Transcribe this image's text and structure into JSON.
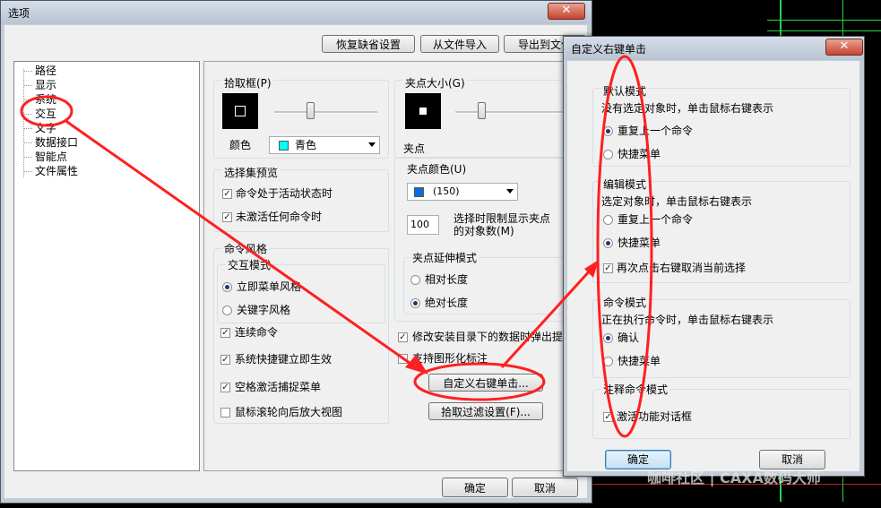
{
  "options_dialog": {
    "title": "选项",
    "close_glyph": "✕",
    "top_buttons": {
      "restore": "恢复缺省设置",
      "import": "从文件导入",
      "export": "导出到文件"
    },
    "tree": [
      "路径",
      "显示",
      "系统",
      "交互",
      "文字",
      "数据接口",
      "智能点",
      "文件属性"
    ],
    "pickbox": {
      "title": "拾取框(P)",
      "color_label": "颜色",
      "color_value": "青色",
      "color_hex": "#00ffff"
    },
    "grip_size": {
      "title": "夹点大小(G)"
    },
    "grip": {
      "title": "夹点",
      "color_label": "夹点颜色(U)",
      "color_value": "(150)",
      "color_hex": "#0a6edc",
      "limit_value": "100",
      "limit_label_1": "选择时限制显示夹点",
      "limit_label_2": "的对象数(M)"
    },
    "grip_extend": {
      "title": "夹点延伸模式",
      "relative": "相对长度",
      "absolute": "绝对长度"
    },
    "selection_preview": {
      "title": "选择集预览",
      "opt1": "命令处于活动状态时",
      "opt2": "未激活任何命令时"
    },
    "command_style": {
      "title": "命令风格",
      "interact_title": "交互模式",
      "menu_style": "立即菜单风格",
      "keyword_style": "关键字风格"
    },
    "checks": {
      "continuous": "连续命令",
      "shortcut": "系统快捷键立即生效",
      "space": "空格激活捕捉菜单",
      "wheel": "鼠标滚轮向后放大视图",
      "modify_install": "修改安装目录下的数据时弹出提",
      "support_graphic": "支持图形化标注"
    },
    "custom_right_click_btn": "自定义右键单击...",
    "pick_filter_btn": "拾取过滤设置(F)...",
    "ok": "确定",
    "cancel": "取消"
  },
  "right_click_dialog": {
    "title": "自定义右键单击",
    "close_glyph": "✕",
    "default_mode": {
      "title": "默认模式",
      "desc": "没有选定对象时，单击鼠标右键表示",
      "opt1": "重复上一个命令",
      "opt2": "快捷菜单"
    },
    "edit_mode": {
      "title": "编辑模式",
      "desc": "选定对象时，单击鼠标右键表示",
      "opt1": "重复上一个命令",
      "opt2": "快捷菜单",
      "check": "再次点击右键取消当前选择"
    },
    "command_mode": {
      "title": "命令模式",
      "desc": "正在执行命令时，单击鼠标右键表示",
      "opt1": "确认",
      "opt2": "快捷菜单"
    },
    "annotate_mode": {
      "title": "注释命令模式",
      "check": "激活功能对话框"
    },
    "ok": "确定",
    "cancel": "取消"
  },
  "watermark": "咖啡社区 | CAXA数码大师",
  "colors": {
    "annotation_red": "#ff2020",
    "cad_green": "#2ad04a"
  }
}
